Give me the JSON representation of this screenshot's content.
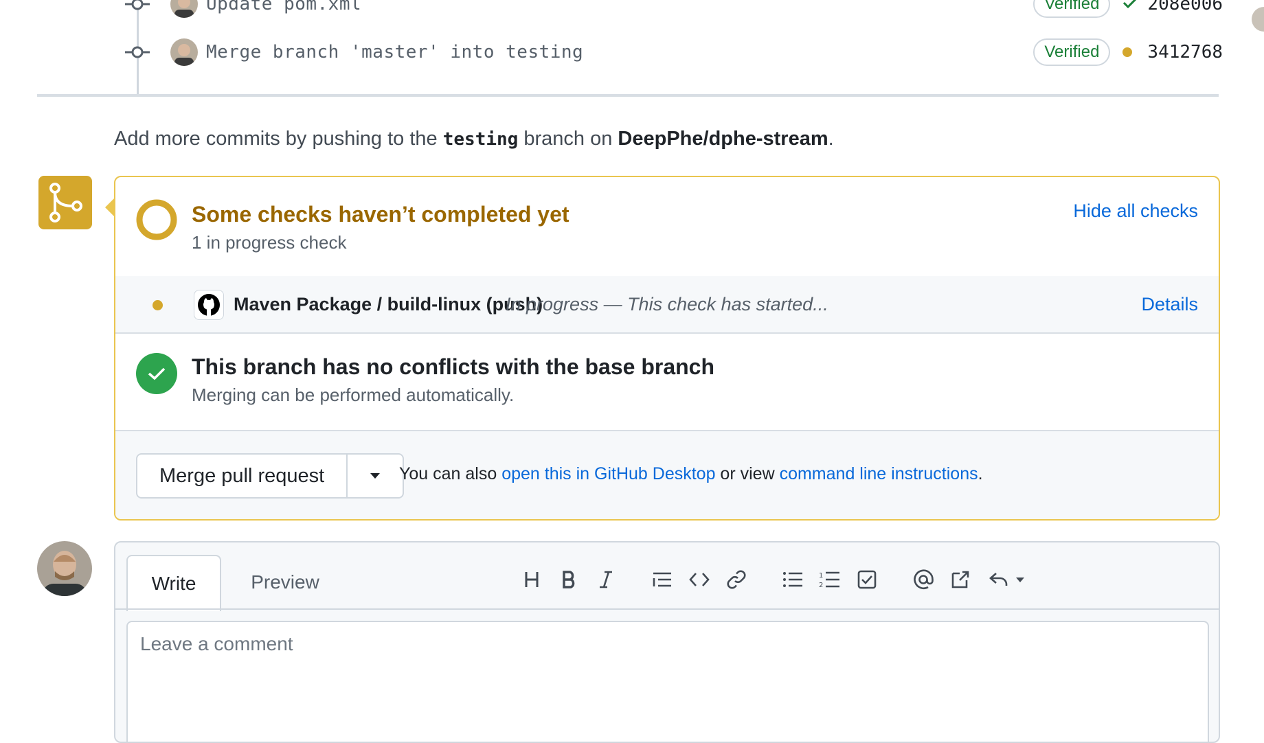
{
  "commits": [
    {
      "message": "Update pom.xml",
      "badge": "Verified",
      "sha": "208e006",
      "status": "success"
    },
    {
      "message": "Merge branch 'master' into testing",
      "badge": "Verified",
      "sha": "3412768",
      "status": "pending"
    }
  ],
  "hint": {
    "prefix": "Add more commits by pushing to the ",
    "branch": "testing",
    "middle": " branch on ",
    "repo": "DeepPhe/dphe-stream",
    "suffix": "."
  },
  "checks": {
    "title": "Some checks haven’t completed yet",
    "subtitle": "1 in progress check",
    "toggle_label": "Hide all checks",
    "items": [
      {
        "name": "Maven Package / build-linux (push)",
        "status": "In progress — This check has started...",
        "details_label": "Details"
      }
    ]
  },
  "conflicts": {
    "title": "This branch has no conflicts with the base branch",
    "subtitle": "Merging can be performed automatically."
  },
  "merge": {
    "button_label": "Merge pull request",
    "also_prefix": "You can also ",
    "desktop_link": "open this in GitHub Desktop",
    "also_middle": " or view ",
    "cli_link": "command line instructions",
    "also_suffix": "."
  },
  "comment": {
    "tabs": [
      "Write",
      "Preview"
    ],
    "placeholder": "Leave a comment",
    "toolbar_icons": [
      "heading-icon",
      "bold-icon",
      "italic-icon",
      "quote-icon",
      "code-icon",
      "link-icon",
      "unordered-list-icon",
      "ordered-list-icon",
      "task-list-icon",
      "mention-icon",
      "reference-icon",
      "reply-icon"
    ]
  },
  "colors": {
    "pending": "#d4a72c",
    "pending_text": "#9a6700",
    "success": "#2da44e",
    "link": "#0969da"
  }
}
